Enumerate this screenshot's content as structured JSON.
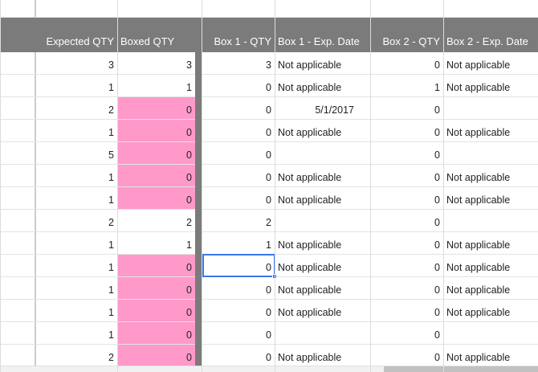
{
  "colors": {
    "header_bg": "#7b7b7b",
    "header_text": "#ffffff",
    "highlight_pink": "#ff99c9",
    "selection_blue": "#3b78e7",
    "grid_line": "#dadce0"
  },
  "header": {
    "expected_qty": "Expected QTY",
    "boxed_qty": "Boxed QTY",
    "box1_qty": "Box 1 - QTY",
    "box1_exp": "Box 1 - Exp. Date",
    "box2_qty": "Box 2 - QTY",
    "box2_exp": "Box 2 - Exp. Date"
  },
  "rows": [
    {
      "expected": "3",
      "boxed": "3",
      "b1q": "3",
      "b1e": "Not applicable",
      "b2q": "0",
      "b2e": "Not applicable",
      "pink": false
    },
    {
      "expected": "1",
      "boxed": "1",
      "b1q": "0",
      "b1e": "Not applicable",
      "b2q": "1",
      "b2e": "Not applicable",
      "pink": false
    },
    {
      "expected": "2",
      "boxed": "0",
      "b1q": "0",
      "b1e": "5/1/2017",
      "b2q": "0",
      "b2e": "",
      "pink": true
    },
    {
      "expected": "1",
      "boxed": "0",
      "b1q": "0",
      "b1e": "Not applicable",
      "b2q": "0",
      "b2e": "Not applicable",
      "pink": true
    },
    {
      "expected": "5",
      "boxed": "0",
      "b1q": "0",
      "b1e": "",
      "b2q": "0",
      "b2e": "",
      "pink": true
    },
    {
      "expected": "1",
      "boxed": "0",
      "b1q": "0",
      "b1e": "Not applicable",
      "b2q": "0",
      "b2e": "Not applicable",
      "pink": true
    },
    {
      "expected": "1",
      "boxed": "0",
      "b1q": "0",
      "b1e": "Not applicable",
      "b2q": "0",
      "b2e": "Not applicable",
      "pink": true
    },
    {
      "expected": "2",
      "boxed": "2",
      "b1q": "2",
      "b1e": "",
      "b2q": "0",
      "b2e": "",
      "pink": false
    },
    {
      "expected": "1",
      "boxed": "1",
      "b1q": "1",
      "b1e": "Not applicable",
      "b2q": "0",
      "b2e": "Not applicable",
      "pink": false
    },
    {
      "expected": "1",
      "boxed": "0",
      "b1q": "0",
      "b1e": "Not applicable",
      "b2q": "0",
      "b2e": "Not applicable",
      "pink": true
    },
    {
      "expected": "1",
      "boxed": "0",
      "b1q": "0",
      "b1e": "Not applicable",
      "b2q": "0",
      "b2e": "Not applicable",
      "pink": true
    },
    {
      "expected": "1",
      "boxed": "0",
      "b1q": "0",
      "b1e": "Not applicable",
      "b2q": "0",
      "b2e": "Not applicable",
      "pink": true
    },
    {
      "expected": "1",
      "boxed": "0",
      "b1q": "0",
      "b1e": "",
      "b2q": "0",
      "b2e": "",
      "pink": true
    },
    {
      "expected": "2",
      "boxed": "0",
      "b1q": "0",
      "b1e": "Not applicable",
      "b2q": "0",
      "b2e": "Not applicable",
      "pink": true
    }
  ],
  "selection": {
    "row_index": 9,
    "column": "b1q"
  }
}
